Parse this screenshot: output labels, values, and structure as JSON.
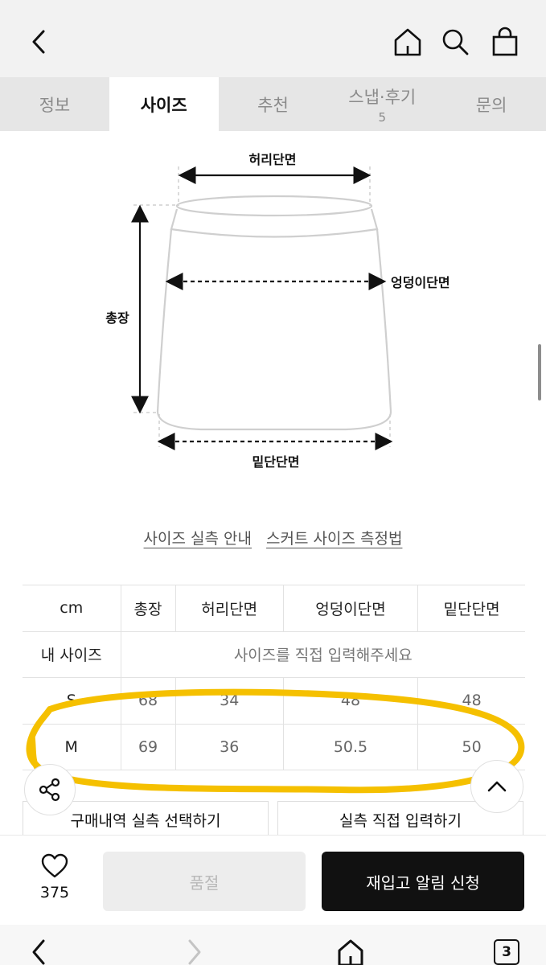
{
  "tabs": [
    {
      "label": "정보",
      "badge": ""
    },
    {
      "label": "사이즈",
      "badge": ""
    },
    {
      "label": "추천",
      "badge": ""
    },
    {
      "label": "스냅·후기",
      "badge": "5"
    },
    {
      "label": "문의",
      "badge": ""
    }
  ],
  "active_tab": "사이즈",
  "diagram": {
    "waist_label": "허리단면",
    "hip_label": "엉덩이단면",
    "length_label": "총장",
    "hem_label": "밑단단면"
  },
  "links": {
    "guide": "사이즈 실측 안내",
    "howto": "스커트 사이즈 측정법"
  },
  "size_table": {
    "unit": "cm",
    "headers": [
      "총장",
      "허리단면",
      "엉덩이단면",
      "밑단단면"
    ],
    "my_size_label": "내 사이즈",
    "my_size_hint": "사이즈를 직접 입력해주세요",
    "rows": [
      {
        "size": "S",
        "values": [
          "68",
          "34",
          "48",
          "48"
        ]
      },
      {
        "size": "M",
        "values": [
          "69",
          "36",
          "50.5",
          "50"
        ]
      }
    ]
  },
  "actions": {
    "purchase_select": "구매내역 실측 선택하기",
    "direct_input": "실측 직접 입력하기"
  },
  "bottom": {
    "like_count": "375",
    "soldout_label": "품절",
    "restock_label": "재입고 알림 신청"
  },
  "nav": {
    "tab_count": "3"
  },
  "colors": {
    "highlight": "#f5c000",
    "active_button": "#111111"
  },
  "icons": [
    "back-icon",
    "home-icon",
    "search-icon",
    "bag-icon",
    "share-icon",
    "chevron-up-icon",
    "heart-icon",
    "nav-back-icon",
    "nav-forward-icon",
    "nav-home-icon"
  ]
}
